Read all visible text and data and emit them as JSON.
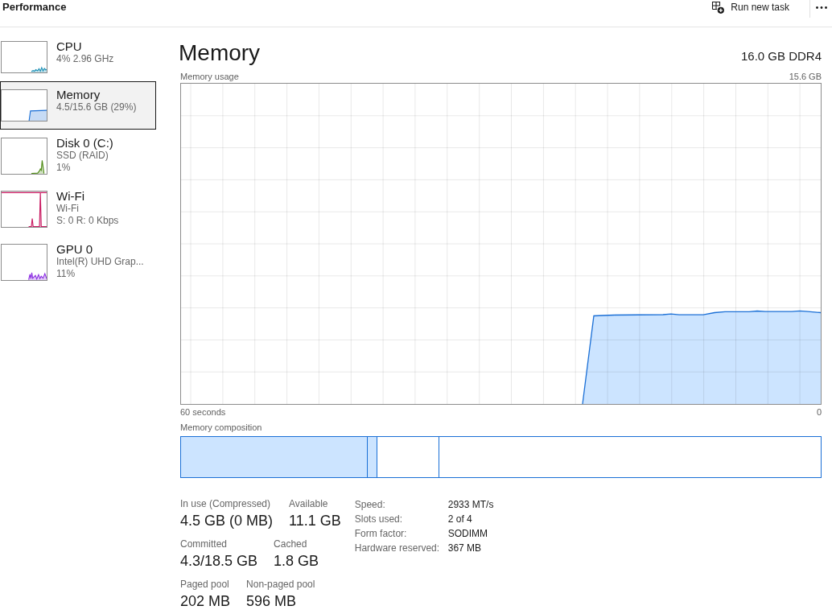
{
  "header": {
    "title": "Performance",
    "run_task_label": "Run new task"
  },
  "sidebar": {
    "items": [
      {
        "title": "CPU",
        "details": [
          "4% 2.96 GHz"
        ],
        "selected": false,
        "color": "#1b8fb5"
      },
      {
        "title": "Memory",
        "details": [
          "4.5/15.6 GB (29%)"
        ],
        "selected": true,
        "color": "#1a6fd6"
      },
      {
        "title": "Disk 0 (C:)",
        "details": [
          "SSD (RAID)",
          "1%"
        ],
        "selected": false,
        "color": "#4d8a13"
      },
      {
        "title": "Wi-Fi",
        "details": [
          "Wi-Fi",
          "S: 0 R: 0 Kbps"
        ],
        "selected": false,
        "color": "#c8175f"
      },
      {
        "title": "GPU 0",
        "details": [
          "Intel(R) UHD Grap...",
          "11%"
        ],
        "selected": false,
        "color": "#8a2be2"
      }
    ]
  },
  "detail": {
    "title": "Memory",
    "capacity": "16.0 GB DDR4",
    "usage_graph": {
      "label": "Memory usage",
      "max_label": "15.6 GB",
      "start_label": "60 seconds",
      "end_label": "0"
    },
    "composition": {
      "label": "Memory composition"
    },
    "stat_rows": [
      [
        {
          "label": "In use (Compressed)",
          "value": "4.5 GB (0 MB)"
        },
        {
          "label": "Available",
          "value": "11.1 GB"
        }
      ],
      [
        {
          "label": "Committed",
          "value": "4.3/18.5 GB"
        },
        {
          "label": "Cached",
          "value": "1.8 GB"
        }
      ],
      [
        {
          "label": "Paged pool",
          "value": "202 MB"
        },
        {
          "label": "Non-paged pool",
          "value": "596 MB"
        }
      ]
    ],
    "properties": [
      {
        "label": "Speed:",
        "value": "2933 MT/s"
      },
      {
        "label": "Slots used:",
        "value": "2 of 4"
      },
      {
        "label": "Form factor:",
        "value": "SODIMM"
      },
      {
        "label": "Hardware reserved:",
        "value": "367 MB"
      }
    ]
  }
}
